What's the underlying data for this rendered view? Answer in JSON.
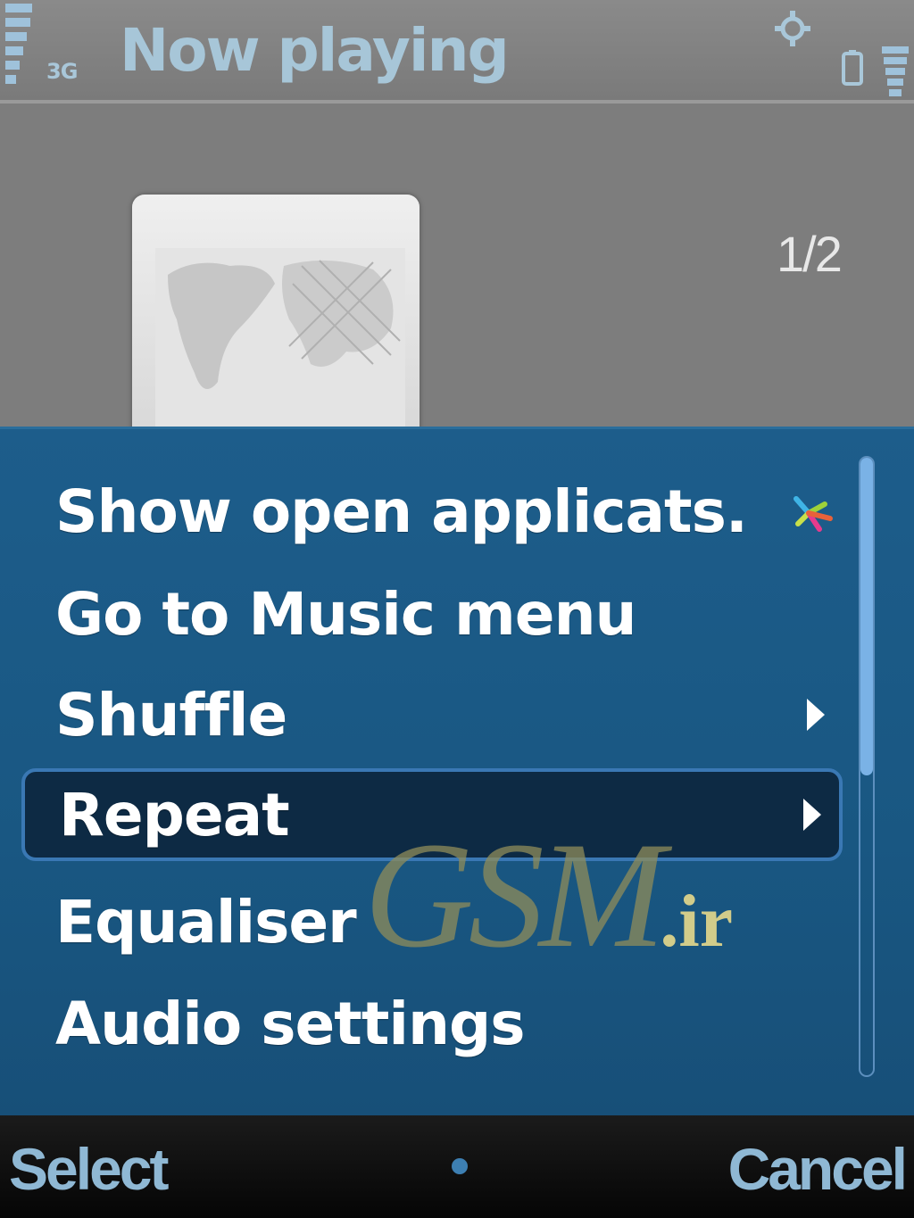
{
  "status_bar": {
    "title": "Now playing",
    "network": "3G",
    "icons": [
      "signal-strength-icon",
      "settings-icon",
      "mini-battery-icon",
      "battery-icon"
    ]
  },
  "now_playing": {
    "track_counter": "1/2",
    "album_art": "world-map-album-art"
  },
  "options_menu": {
    "items": [
      {
        "label": "Show open applicats.",
        "icon": "task-switch-icon",
        "submenu": false,
        "highlighted": false
      },
      {
        "label": "Go to Music menu",
        "submenu": false,
        "highlighted": false
      },
      {
        "label": "Shuffle",
        "submenu": true,
        "highlighted": false
      },
      {
        "label": "Repeat",
        "submenu": true,
        "highlighted": true
      },
      {
        "label": "Equaliser",
        "submenu": false,
        "highlighted": false
      },
      {
        "label": "Audio settings",
        "submenu": false,
        "highlighted": false
      }
    ]
  },
  "watermark": {
    "logo": "GSM",
    "tld": ".ir"
  },
  "softkeys": {
    "left": "Select",
    "right": "Cancel"
  },
  "colors": {
    "menu_background": "#195782",
    "highlight_background": "#0d2a44",
    "highlight_border": "#3a78b4",
    "title_text": "#a7c6d8",
    "softkey_text": "#8fb8d4"
  }
}
